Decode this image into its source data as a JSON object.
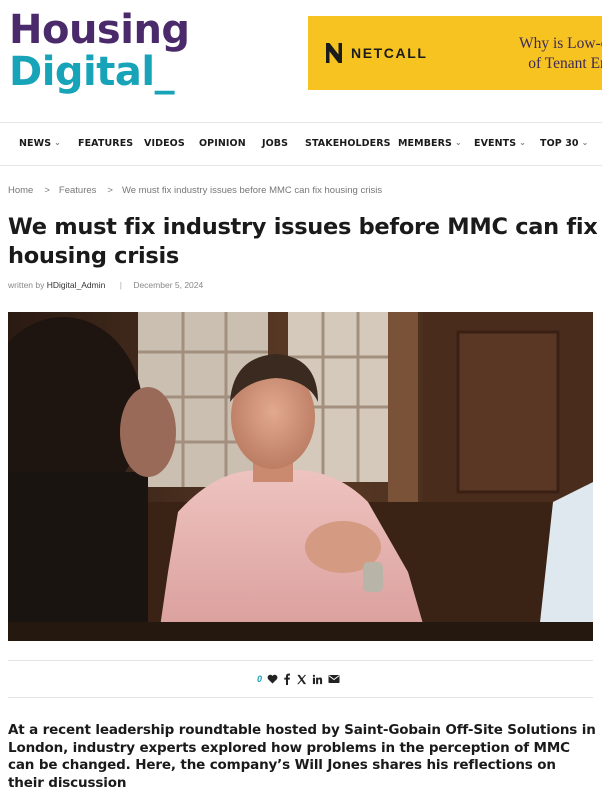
{
  "site": {
    "logo_line1": "Housing",
    "logo_line2": "Digital_",
    "logo_colors": {
      "primary": "#4b2a6b",
      "accent": "#17a3b8"
    }
  },
  "ad": {
    "brand": "NETCALL",
    "line1": "Why is Low-code the Fu",
    "line2": "of Tenant Engagemen",
    "background": "#f7c321"
  },
  "nav": {
    "items": [
      {
        "label": "NEWS",
        "dropdown": true
      },
      {
        "label": "FEATURES",
        "dropdown": false
      },
      {
        "label": "VIDEOS",
        "dropdown": false
      },
      {
        "label": "OPINION",
        "dropdown": false
      },
      {
        "label": "JOBS",
        "dropdown": false
      },
      {
        "label": "STAKEHOLDERS",
        "dropdown": false
      },
      {
        "label": "MEMBERS",
        "dropdown": true
      },
      {
        "label": "EVENTS",
        "dropdown": true
      },
      {
        "label": "TOP 30",
        "dropdown": true
      }
    ],
    "dropdown_glyph": "⌄"
  },
  "breadcrumb": {
    "items": [
      "Home",
      "Features",
      "We must fix industry issues before MMC can fix housing crisis"
    ],
    "separator": ">"
  },
  "article": {
    "title": "We must fix industry issues before MMC can fix housing crisis",
    "meta": {
      "written_by": "written by",
      "author": "HDigital_Admin",
      "separator": "|",
      "date": "December 5, 2024"
    },
    "lead": "At a recent leadership roundtable hosted by Saint-Gobain Off-Site Solutions in London, industry experts explored how problems in the perception of MMC can be changed. Here, the company’s Will Jones shares his reflections on their discussion"
  },
  "share": {
    "count": "0",
    "icons": [
      "heart-icon",
      "facebook-icon",
      "x-icon",
      "linkedin-icon",
      "envelope-icon"
    ],
    "icon_labels": {
      "facebook": "f",
      "x": "𝕏",
      "linkedin": "in"
    }
  }
}
